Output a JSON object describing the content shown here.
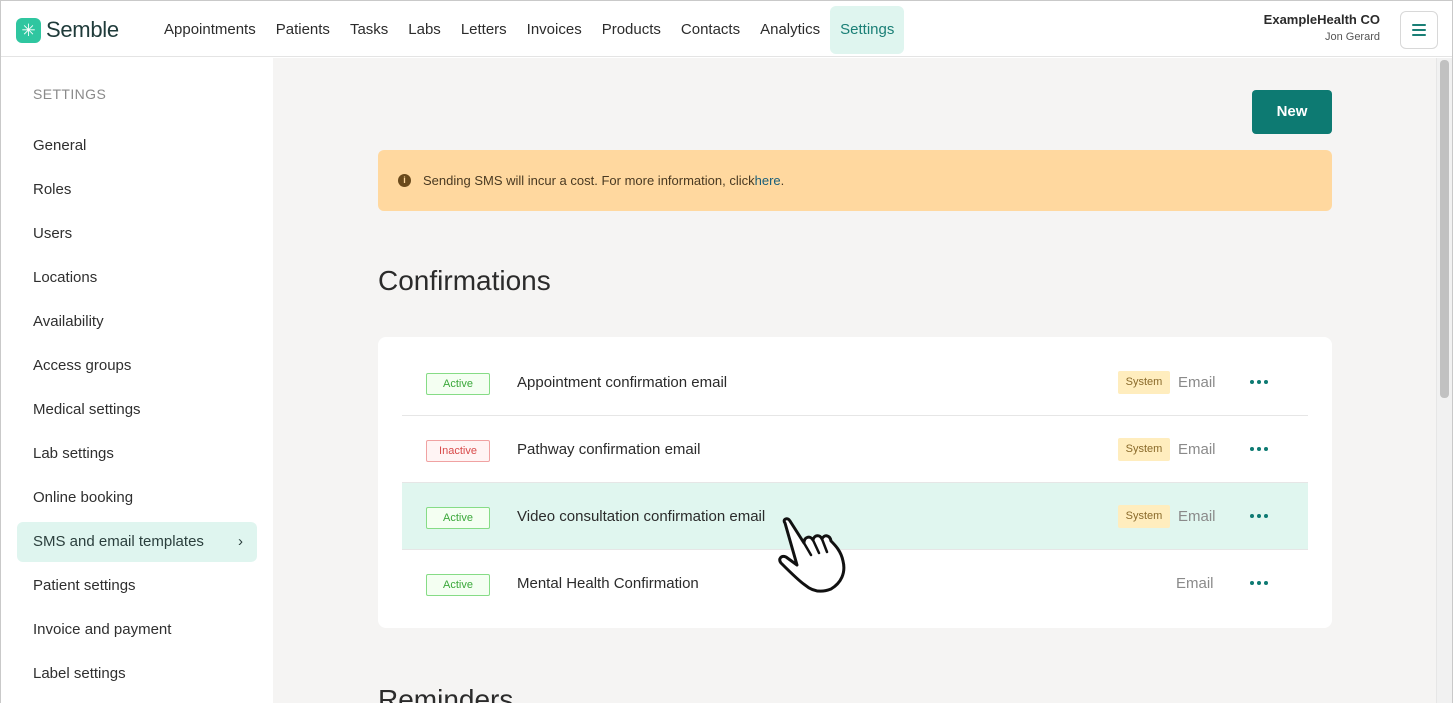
{
  "app": {
    "name": "Semble",
    "colors": {
      "accent": "#0d7a72",
      "active_nav_bg": "#dff5ef",
      "banner_bg": "#ffd89f"
    }
  },
  "nav": {
    "items": [
      "Appointments",
      "Patients",
      "Tasks",
      "Labs",
      "Letters",
      "Invoices",
      "Products",
      "Contacts",
      "Analytics",
      "Settings"
    ],
    "active": "Settings"
  },
  "account": {
    "org": "ExampleHealth CO",
    "user": "Jon Gerard",
    "menu_icon": "hamburger-icon"
  },
  "sidebar": {
    "title": "SETTINGS",
    "items": [
      {
        "label": "General"
      },
      {
        "label": "Roles"
      },
      {
        "label": "Users"
      },
      {
        "label": "Locations"
      },
      {
        "label": "Availability"
      },
      {
        "label": "Access groups"
      },
      {
        "label": "Medical settings"
      },
      {
        "label": "Lab settings"
      },
      {
        "label": "Online booking"
      },
      {
        "label": "SMS and email templates",
        "active": true
      },
      {
        "label": "Patient settings"
      },
      {
        "label": "Invoice and payment"
      },
      {
        "label": "Label settings"
      }
    ]
  },
  "main": {
    "new_button": "New",
    "banner": {
      "text": "Sending SMS will incur a cost. For more information, click ",
      "link": "here",
      "suffix": "."
    },
    "confirmations": {
      "title": "Confirmations",
      "rows": [
        {
          "status": "Active",
          "name": "Appointment confirmation email",
          "system": "System",
          "channel": "Email"
        },
        {
          "status": "Inactive",
          "name": "Pathway confirmation email",
          "system": "System",
          "channel": "Email"
        },
        {
          "status": "Active",
          "name": "Video consultation confirmation email",
          "system": "System",
          "channel": "Email"
        },
        {
          "status": "Active",
          "name": "Mental Health Confirmation",
          "system": "",
          "channel": "Email"
        }
      ]
    },
    "reminders": {
      "title": "Reminders"
    }
  }
}
